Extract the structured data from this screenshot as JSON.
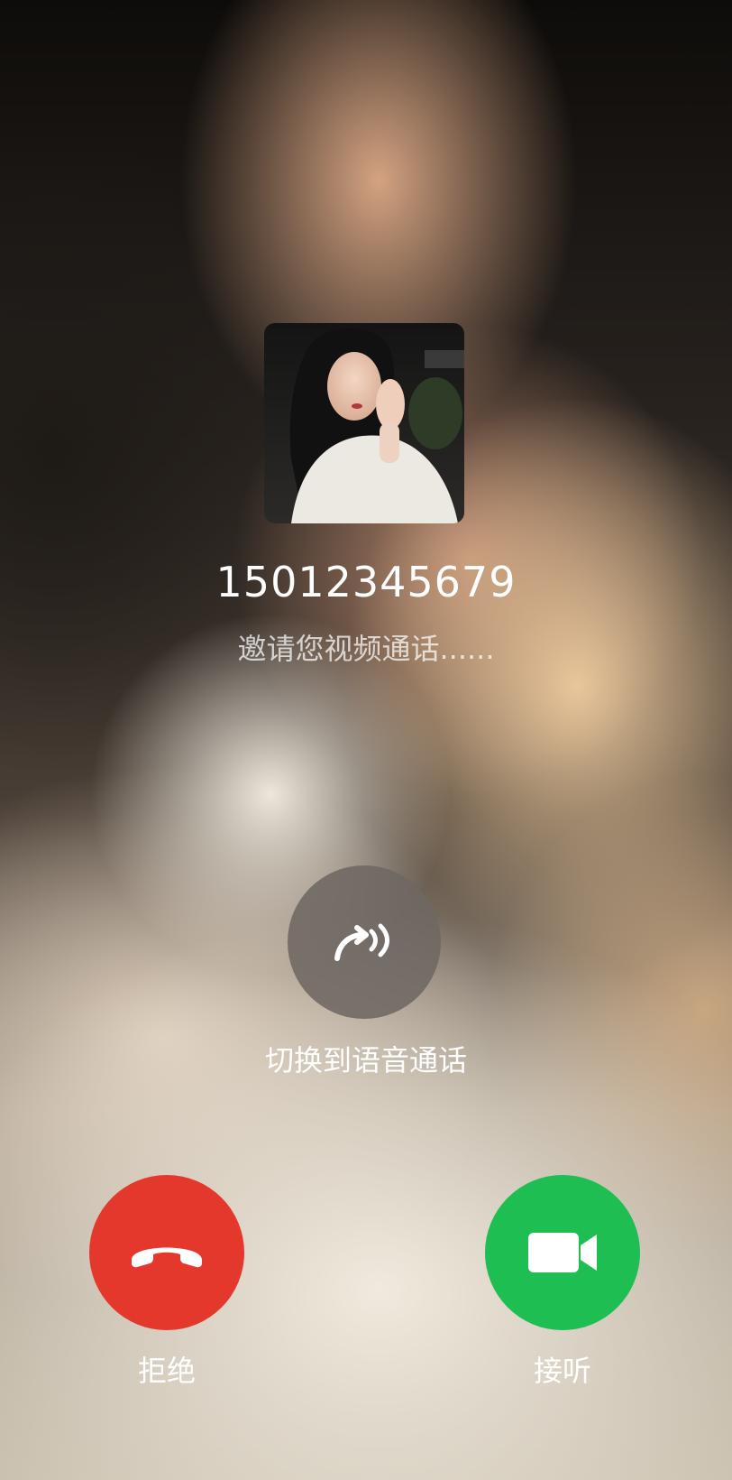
{
  "caller": {
    "number": "15012345679",
    "status": "邀请您视频通话......"
  },
  "actions": {
    "switch_label": "切换到语音通话",
    "reject_label": "拒绝",
    "accept_label": "接听"
  },
  "icons": {
    "switch": "switch-to-voice-icon",
    "reject": "hang-up-phone-icon",
    "accept": "video-camera-icon"
  },
  "colors": {
    "reject": "#e5382d",
    "accept": "#1fbe53",
    "switch": "#6e6862"
  }
}
